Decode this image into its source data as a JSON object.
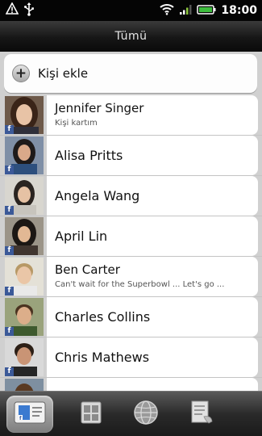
{
  "status_bar": {
    "clock": "18:00",
    "icons": [
      "alert-triangle-icon",
      "usb-icon",
      "wifi-icon",
      "signal-icon",
      "battery-icon"
    ]
  },
  "header": {
    "title": "Tümü"
  },
  "add_contact": {
    "label": "Kişi ekle",
    "icon": "plus-icon"
  },
  "contacts": [
    {
      "name": "Jennifer Singer",
      "subtitle": "Kişi kartım"
    },
    {
      "name": "Alisa Pritts",
      "subtitle": ""
    },
    {
      "name": "Angela Wang",
      "subtitle": ""
    },
    {
      "name": "April  Lin",
      "subtitle": ""
    },
    {
      "name": "Ben  Carter",
      "subtitle": "Can't wait for the Superbowl ... Let's go ..."
    },
    {
      "name": "Charles  Collins",
      "subtitle": ""
    },
    {
      "name": "Chris Mathews",
      "subtitle": ""
    }
  ],
  "tabs": [
    {
      "icon": "people-icon",
      "active": true
    },
    {
      "icon": "groups-icon",
      "active": false
    },
    {
      "icon": "globe-icon",
      "active": false
    },
    {
      "icon": "call-history-icon",
      "active": false
    }
  ],
  "colors": {
    "facebook_badge": "#3b5998",
    "status_bar": "#050505",
    "header": "#161616"
  }
}
